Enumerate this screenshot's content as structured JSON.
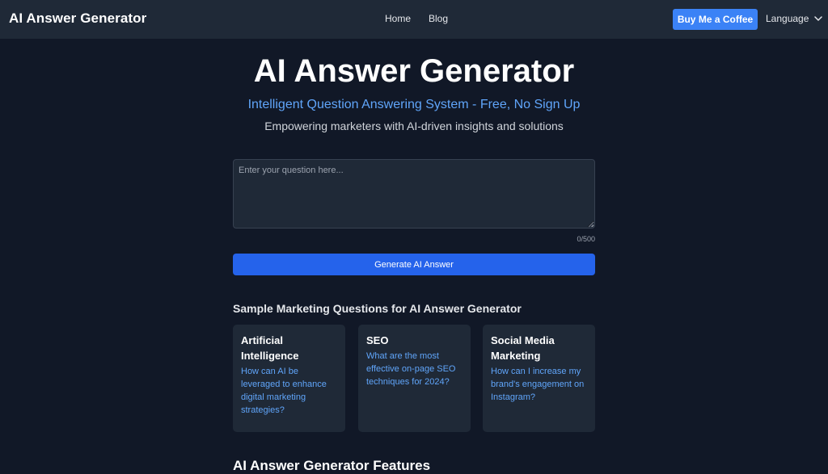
{
  "header": {
    "brand": "AI Answer Generator",
    "nav": [
      {
        "label": "Home"
      },
      {
        "label": "Blog"
      }
    ],
    "coffee_button": "Buy Me a Coffee",
    "language_label": "Language",
    "language_icon": "chevron-down-icon"
  },
  "hero": {
    "title": "AI Answer Generator",
    "subtitle": "Intelligent Question Answering System - Free, No Sign Up",
    "tagline": "Empowering marketers with AI-driven insights and solutions"
  },
  "question_form": {
    "value": "",
    "placeholder": "Enter your question here...",
    "char_count": "0/500",
    "submit_label": "Generate AI Answer"
  },
  "samples": {
    "heading": "Sample Marketing Questions for AI Answer Generator",
    "cards": [
      {
        "title": "Artificial Intelligence",
        "question": "How can AI be leveraged to enhance digital marketing strategies?"
      },
      {
        "title": "SEO",
        "question": "What are the most effective on-page SEO techniques for 2024?"
      },
      {
        "title": "Social Media Marketing",
        "question": "How can I increase my brand's engagement on Instagram?"
      }
    ]
  },
  "features": {
    "heading": "AI Answer Generator Features"
  },
  "colors": {
    "background": "#111827",
    "header_bg": "#1f2937",
    "accent": "#3b82f6",
    "primary_button": "#2563eb",
    "link_blue": "#60a5fa"
  }
}
